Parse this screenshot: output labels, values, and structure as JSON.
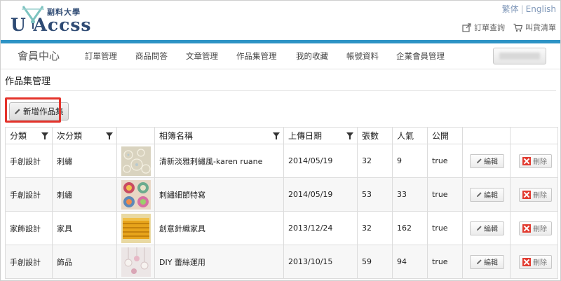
{
  "header": {
    "logo_text": "U Accss",
    "logo_sub": "副料大學",
    "lang_tc": "繁体",
    "lang_en": "English",
    "order_query": "訂單查詢",
    "shopping_list": "叫貨清單"
  },
  "nav": {
    "home": "會員中心",
    "items": [
      "訂單管理",
      "商品問答",
      "文章管理",
      "作品集管理",
      "我的收藏",
      "帳號資料",
      "企業會員管理"
    ]
  },
  "page": {
    "title": "作品集管理",
    "add_button": "新增作品集"
  },
  "table": {
    "headers": [
      "分類",
      "次分類",
      "",
      "相簿名稱",
      "上傳日期",
      "張數",
      "人氣",
      "公開",
      "",
      ""
    ],
    "edit_label": "編輯",
    "delete_label": "刪除",
    "rows": [
      {
        "category": "手創設計",
        "subcategory": "刺繡",
        "thumb": "lace-pattern",
        "album": "清新淡雅刺繡風-karen ruane",
        "date": "2014/05/19",
        "count": "32",
        "popularity": "9",
        "public": "true"
      },
      {
        "category": "手創設計",
        "subcategory": "刺繡",
        "thumb": "embroidery-circles",
        "album": "刺繡細節特寫",
        "date": "2014/05/19",
        "count": "53",
        "popularity": "33",
        "public": "true"
      },
      {
        "category": "家飾設計",
        "subcategory": "家具",
        "thumb": "knit-furniture",
        "album": "創意針織家具",
        "date": "2013/12/24",
        "count": "32",
        "popularity": "162",
        "public": "true"
      },
      {
        "category": "手創設計",
        "subcategory": "飾品",
        "thumb": "lace-ornaments",
        "album": "DIY 蕾絲運用",
        "date": "2013/10/15",
        "count": "59",
        "popularity": "94",
        "public": "true"
      }
    ]
  },
  "colors": {
    "accent_bar": "#2d93c5",
    "highlight": "#e4332b",
    "logo": "#2e4a73"
  }
}
